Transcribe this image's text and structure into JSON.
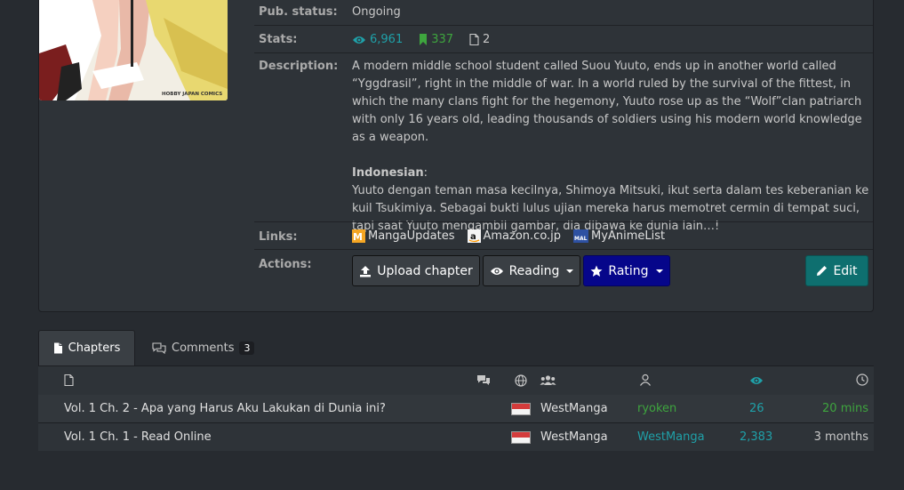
{
  "details": {
    "pub_status_label": "Pub. status:",
    "pub_status_value": "Ongoing",
    "stats_label": "Stats:",
    "stats_views": "6,961",
    "stats_follows": "337",
    "stats_chapters": "2",
    "description_label": "Description:",
    "description_en": "A modern middle school student called Suou Yuuto, ends up in another world called “Yggdrasil”, right in the middle of war. In a world ruled by the survival of the fittest, in which the many clans fight for the hegemony, Yuuto rose up as the “Wolf”clan patriarch with only 16 years old, leading thousands of soldiers using his modern world knowledge as a weapon.",
    "description_id_heading": "Indonesian",
    "description_id_colon": ":",
    "description_id": "Yuuto dengan teman masa kecilnya, Shimoya Mitsuki, ikut serta dalam tes keberanian ke kuil Tsukimiya. Sebagai bukti lulus ujian mereka harus memotret cermin di tempat suci, tapi saat Yuuto mengambil gambar, dia dibawa ke dunia lain…!",
    "cover_publisher_text": "HOBBY JAPAN COMICS",
    "links_label": "Links:",
    "links": [
      {
        "label": "MangaUpdates",
        "icon": "mangaupdates-icon"
      },
      {
        "label": "Amazon.co.jp",
        "icon": "amazon-icon"
      },
      {
        "label": "MyAnimeList",
        "icon": "myanimelist-icon"
      }
    ],
    "actions_label": "Actions:",
    "actions": {
      "upload": "Upload chapter",
      "reading": "Reading",
      "rating": "Rating",
      "edit": "Edit"
    }
  },
  "tabs": [
    {
      "label": "Chapters",
      "icon": "file-icon",
      "active": true
    },
    {
      "label": "Comments",
      "icon": "comments-icon",
      "badge": "3"
    }
  ],
  "chapters": [
    {
      "title": "Vol. 1 Ch. 2 - Apa yang Harus Aku Lakukan di Dunia ini?",
      "group": "WestManga",
      "uploader": "ryoken",
      "views": "26",
      "time": "20 mins"
    },
    {
      "title": "Vol. 1 Ch. 1 - Read Online",
      "group": "WestManga",
      "uploader": "WestManga",
      "views": "2,383",
      "time": "3 months"
    }
  ],
  "colors": {
    "accent_teal": "#1fa0a8",
    "accent_green": "#3ea53e",
    "rating_navy": "#06068a",
    "edit_teal": "#0e6f6f"
  }
}
